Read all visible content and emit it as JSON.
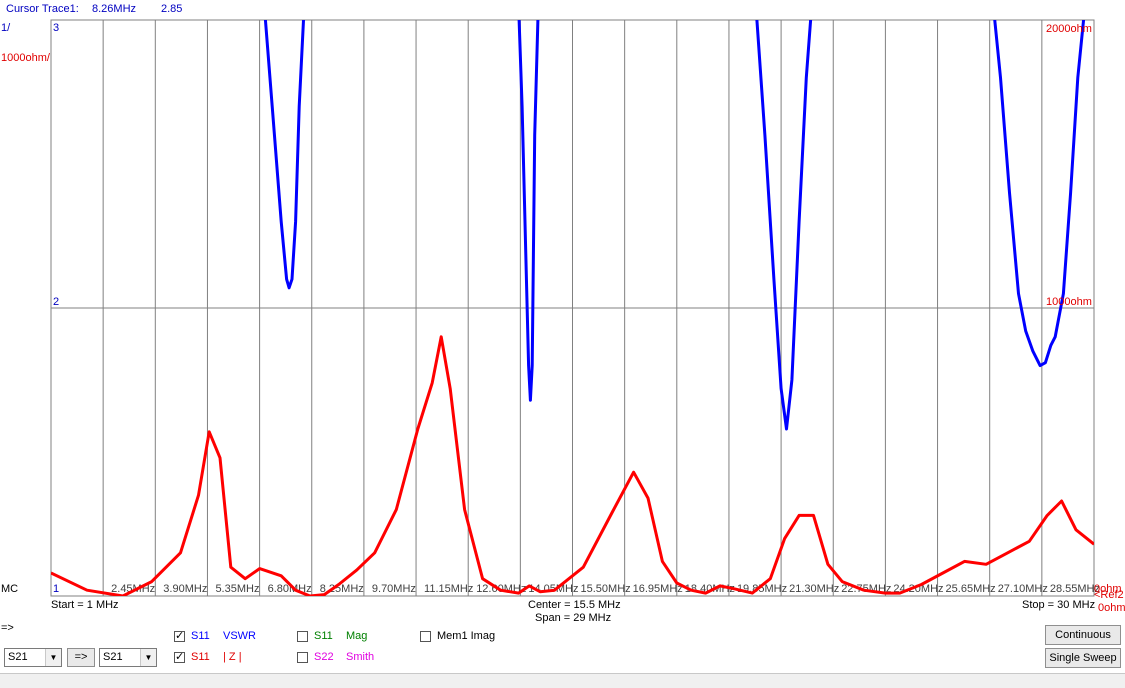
{
  "header": {
    "cursor_label": "Cursor Trace1:",
    "cursor_freq": "8.26MHz",
    "cursor_value": "2.85"
  },
  "left_scale": {
    "top": "3",
    "mid": "2",
    "bottom": "1",
    "unit1": "1/",
    "unit2": "1000ohm/",
    "mode": "MC"
  },
  "right_scale": {
    "top": "2000ohm",
    "mid": "1000ohm",
    "bottom": "0ohm",
    "ref_marker": "<Ref2",
    "bottom2": "0ohm"
  },
  "footer": {
    "start": "Start = 1 MHz",
    "center": "Center = 15.5 MHz",
    "span": "Span = 29 MHz",
    "stop": "Stop = 30 MHz"
  },
  "controls": {
    "arrow_label": "=>",
    "select1": "S21",
    "arrow_button": "=>",
    "select2": "S21",
    "traces": [
      {
        "param": "S11",
        "name": "VSWR",
        "checked": true,
        "color": "#0000ff"
      },
      {
        "param": "S11",
        "name": "| Z |",
        "checked": true,
        "color": "#ff0000"
      },
      {
        "param": "S11",
        "name": "Mag",
        "checked": false,
        "color": "#008000"
      },
      {
        "param": "S22",
        "name": "Smith",
        "checked": false,
        "color": "#e000e0"
      }
    ],
    "mem_label": "Mem1 Imag",
    "continuous": "Continuous",
    "single_sweep": "Single Sweep"
  },
  "chart_data": {
    "type": "line",
    "x_unit": "MHz",
    "xlim": [
      1,
      30
    ],
    "x_tick_labels": [
      "2.45MHz",
      "3.90MHz",
      "5.35MHz",
      "6.80MHz",
      "8.25MHz",
      "9.70MHz",
      "11.15MHz",
      "12.60MHz",
      "14.05MHz",
      "15.50MHz",
      "16.95MHz",
      "18.40MHz",
      "19.85MHz",
      "21.30MHz",
      "22.75MHz",
      "24.20MHz",
      "25.65MHz",
      "27.10MHz",
      "28.55MHz"
    ],
    "x_ticks": [
      2.45,
      3.9,
      5.35,
      6.8,
      8.25,
      9.7,
      11.15,
      12.6,
      14.05,
      15.5,
      16.95,
      18.4,
      19.85,
      21.3,
      22.75,
      24.2,
      25.65,
      27.1,
      28.55
    ],
    "left_axis": {
      "ylim": [
        1,
        3
      ],
      "ticks": [
        "1",
        "2",
        "3"
      ]
    },
    "right_axis": {
      "ylim": [
        0,
        2000
      ],
      "ticks": [
        "0ohm",
        "1000ohm",
        "2000ohm"
      ]
    },
    "series": [
      {
        "name": "VSWR",
        "axis": "left",
        "color": "#0000ff",
        "segments": [
          {
            "x": [
              6.93,
              7.15,
              7.4,
              7.55,
              7.62,
              7.7,
              7.8,
              7.9,
              8.02,
              8.15
            ],
            "y": [
              3.05,
              2.7,
              2.3,
              2.1,
              2.07,
              2.1,
              2.3,
              2.7,
              3.0,
              3.05
            ]
          },
          {
            "x": [
              14.0,
              14.1,
              14.2,
              14.28,
              14.33,
              14.38,
              14.45,
              14.55
            ],
            "y": [
              3.05,
              2.7,
              2.2,
              1.8,
              1.68,
              1.8,
              2.6,
              3.05
            ]
          },
          {
            "x": [
              20.6,
              20.85,
              21.1,
              21.3,
              21.45,
              21.6,
              21.8,
              22.0,
              22.15
            ],
            "y": [
              3.05,
              2.6,
              2.1,
              1.72,
              1.58,
              1.75,
              2.3,
              2.8,
              3.05
            ]
          },
          {
            "x": [
              27.2,
              27.4,
              27.65,
              27.9,
              28.1,
              28.3,
              28.5,
              28.65,
              28.8,
              28.92,
              29.15,
              29.35,
              29.55,
              29.75
            ],
            "y": [
              3.05,
              2.8,
              2.4,
              2.05,
              1.92,
              1.85,
              1.8,
              1.81,
              1.87,
              1.9,
              2.05,
              2.4,
              2.8,
              3.05
            ]
          }
        ]
      },
      {
        "name": "|Z|",
        "axis": "right",
        "color": "#ff0000",
        "x": [
          1,
          2,
          3,
          3.8,
          4.6,
          5.1,
          5.4,
          5.7,
          6.0,
          6.4,
          6.8,
          7.4,
          7.8,
          8.2,
          8.6,
          9.0,
          9.5,
          10,
          10.6,
          11.2,
          11.6,
          11.85,
          12.1,
          12.5,
          13.0,
          13.5,
          14.0,
          14.3,
          14.6,
          15.0,
          15.8,
          16.6,
          17.2,
          17.6,
          18.0,
          18.4,
          18.8,
          19.2,
          19.6,
          20.0,
          20.5,
          21.0,
          21.4,
          21.8,
          22.2,
          22.6,
          23.0,
          23.6,
          24.2,
          24.6,
          25.2,
          25.8,
          26.4,
          27.0,
          27.6,
          28.2,
          28.7,
          29.1,
          29.5,
          30
        ],
        "y": [
          80,
          20,
          0,
          50,
          150,
          350,
          570,
          480,
          100,
          60,
          95,
          70,
          20,
          0,
          5,
          40,
          90,
          150,
          300,
          580,
          740,
          900,
          720,
          300,
          60,
          20,
          10,
          35,
          15,
          20,
          100,
          290,
          430,
          340,
          120,
          45,
          20,
          10,
          35,
          25,
          10,
          60,
          200,
          280,
          280,
          110,
          50,
          20,
          10,
          10,
          40,
          80,
          120,
          110,
          150,
          190,
          280,
          330,
          230,
          180
        ]
      }
    ]
  }
}
